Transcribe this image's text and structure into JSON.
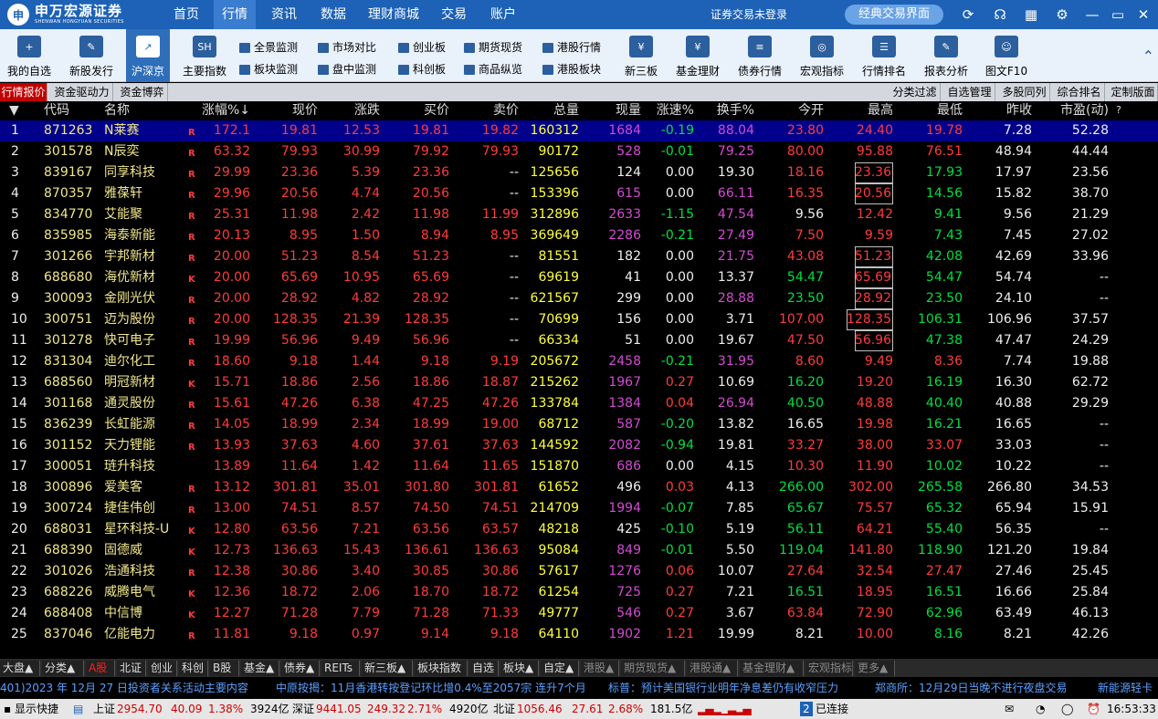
{
  "brand": {
    "cn": "申万宏源证券",
    "en": "SHENWAN HONGYUAN SECURITIES"
  },
  "top_menu": [
    "首页",
    "行情",
    "资讯",
    "数据",
    "理财商城",
    "交易",
    "账户"
  ],
  "top_menu_active": "行情",
  "trade_status": "证券交易未登录",
  "classic_button": "经典交易界面",
  "toolbar": {
    "big": [
      "我的自选",
      "新股发行",
      "沪深京",
      "主要指数",
      "新三板",
      "基金理财",
      "债券行情",
      "宏观指标",
      "行情排名",
      "报表分析",
      "图文F10"
    ],
    "active": "沪深京",
    "small_row1": [
      "全景监测",
      "市场对比",
      "创业板",
      "期货现货",
      "港股行情"
    ],
    "small_row2": [
      "板块监测",
      "盘中监测",
      "科创板",
      "商品纵览",
      "港股板块"
    ]
  },
  "subtabs_left": [
    "行情报价",
    "资金驱动力",
    "资金博弈"
  ],
  "subtabs_right": [
    "分类过滤",
    "自选管理",
    "多股同列",
    "综合排名",
    "定制版面"
  ],
  "columns": [
    "代码",
    "名称",
    "涨幅%↓",
    "现价",
    "涨跌",
    "买价",
    "卖价",
    "总量",
    "现量",
    "涨速%",
    "换手%",
    "今开",
    "最高",
    "最低",
    "昨收",
    "市盈(动)"
  ],
  "rows": [
    {
      "i": "1",
      "code": "871263",
      "name": "N莱赛",
      "flag": "R",
      "chg": "172.1",
      "price": "19.81",
      "diff": "12.53",
      "bid": "19.81",
      "ask": "19.82",
      "vol": "160312",
      "cur": "1684",
      "spd": "-0.19",
      "turn": "88.04",
      "open": "23.80",
      "high": "24.40",
      "low": "19.78",
      "prev": "7.28",
      "pe": "52.28"
    },
    {
      "i": "2",
      "code": "301578",
      "name": "N辰奕",
      "flag": "R",
      "chg": "63.32",
      "price": "79.93",
      "diff": "30.99",
      "bid": "79.92",
      "ask": "79.93",
      "vol": "90172",
      "cur": "528",
      "spd": "-0.01",
      "turn": "79.25",
      "open": "80.00",
      "high": "95.88",
      "low": "76.51",
      "prev": "48.94",
      "pe": "44.44"
    },
    {
      "i": "3",
      "code": "839167",
      "name": "同享科技",
      "flag": "R",
      "chg": "29.99",
      "price": "23.36",
      "diff": "5.39",
      "bid": "23.36",
      "ask": "--",
      "vol": "125656",
      "cur": "124",
      "spd": "0.00",
      "turn": "19.30",
      "open": "18.16",
      "high": "23.36",
      "low": "17.93",
      "prev": "17.97",
      "pe": "23.56"
    },
    {
      "i": "4",
      "code": "870357",
      "name": "雅葆轩",
      "flag": "R",
      "chg": "29.96",
      "price": "20.56",
      "diff": "4.74",
      "bid": "20.56",
      "ask": "--",
      "vol": "153396",
      "cur": "615",
      "spd": "0.00",
      "turn": "66.11",
      "open": "16.35",
      "high": "20.56",
      "low": "14.56",
      "prev": "15.82",
      "pe": "38.70"
    },
    {
      "i": "5",
      "code": "834770",
      "name": "艾能聚",
      "flag": "R",
      "chg": "25.31",
      "price": "11.98",
      "diff": "2.42",
      "bid": "11.98",
      "ask": "11.99",
      "vol": "312896",
      "cur": "2633",
      "spd": "-1.15",
      "turn": "47.54",
      "open": "9.56",
      "high": "12.42",
      "low": "9.41",
      "prev": "9.56",
      "pe": "21.29"
    },
    {
      "i": "6",
      "code": "835985",
      "name": "海泰新能",
      "flag": "R",
      "chg": "20.13",
      "price": "8.95",
      "diff": "1.50",
      "bid": "8.94",
      "ask": "8.95",
      "vol": "369649",
      "cur": "2286",
      "spd": "-0.21",
      "turn": "27.49",
      "open": "7.50",
      "high": "9.59",
      "low": "7.43",
      "prev": "7.45",
      "pe": "27.02"
    },
    {
      "i": "7",
      "code": "301266",
      "name": "宇邦新材",
      "flag": "R",
      "chg": "20.00",
      "price": "51.23",
      "diff": "8.54",
      "bid": "51.23",
      "ask": "--",
      "vol": "81551",
      "cur": "182",
      "spd": "0.00",
      "turn": "21.75",
      "open": "43.08",
      "high": "51.23",
      "low": "42.08",
      "prev": "42.69",
      "pe": "33.96"
    },
    {
      "i": "8",
      "code": "688680",
      "name": "海优新材",
      "flag": "K",
      "chg": "20.00",
      "price": "65.69",
      "diff": "10.95",
      "bid": "65.69",
      "ask": "--",
      "vol": "69619",
      "cur": "41",
      "spd": "0.00",
      "turn": "13.37",
      "open": "54.47",
      "high": "65.69",
      "low": "54.47",
      "prev": "54.74",
      "pe": "--"
    },
    {
      "i": "9",
      "code": "300093",
      "name": "金刚光伏",
      "flag": "R",
      "chg": "20.00",
      "price": "28.92",
      "diff": "4.82",
      "bid": "28.92",
      "ask": "--",
      "vol": "621567",
      "cur": "299",
      "spd": "0.00",
      "turn": "28.88",
      "open": "23.50",
      "high": "28.92",
      "low": "23.50",
      "prev": "24.10",
      "pe": "--"
    },
    {
      "i": "10",
      "code": "300751",
      "name": "迈为股份",
      "flag": "R",
      "chg": "20.00",
      "price": "128.35",
      "diff": "21.39",
      "bid": "128.35",
      "ask": "--",
      "vol": "70699",
      "cur": "156",
      "spd": "0.00",
      "turn": "3.71",
      "open": "107.00",
      "high": "128.35",
      "low": "106.31",
      "prev": "106.96",
      "pe": "37.57"
    },
    {
      "i": "11",
      "code": "301278",
      "name": "快可电子",
      "flag": "R",
      "chg": "19.99",
      "price": "56.96",
      "diff": "9.49",
      "bid": "56.96",
      "ask": "--",
      "vol": "66334",
      "cur": "51",
      "spd": "0.00",
      "turn": "19.67",
      "open": "47.50",
      "high": "56.96",
      "low": "47.38",
      "prev": "47.47",
      "pe": "24.29"
    },
    {
      "i": "12",
      "code": "831304",
      "name": "迪尔化工",
      "flag": "R",
      "chg": "18.60",
      "price": "9.18",
      "diff": "1.44",
      "bid": "9.18",
      "ask": "9.19",
      "vol": "205672",
      "cur": "2458",
      "spd": "-0.21",
      "turn": "31.95",
      "open": "8.60",
      "high": "9.49",
      "low": "8.36",
      "prev": "7.74",
      "pe": "19.88"
    },
    {
      "i": "13",
      "code": "688560",
      "name": "明冠新材",
      "flag": "K",
      "chg": "15.71",
      "price": "18.86",
      "diff": "2.56",
      "bid": "18.86",
      "ask": "18.87",
      "vol": "215262",
      "cur": "1967",
      "spd": "0.27",
      "turn": "10.69",
      "open": "16.20",
      "high": "19.20",
      "low": "16.19",
      "prev": "16.30",
      "pe": "62.72"
    },
    {
      "i": "14",
      "code": "301168",
      "name": "通灵股份",
      "flag": "R",
      "chg": "15.61",
      "price": "47.26",
      "diff": "6.38",
      "bid": "47.25",
      "ask": "47.26",
      "vol": "133784",
      "cur": "1384",
      "spd": "0.04",
      "turn": "26.94",
      "open": "40.50",
      "high": "48.88",
      "low": "40.40",
      "prev": "40.88",
      "pe": "29.29"
    },
    {
      "i": "15",
      "code": "836239",
      "name": "长虹能源",
      "flag": "R",
      "chg": "14.05",
      "price": "18.99",
      "diff": "2.34",
      "bid": "18.99",
      "ask": "19.00",
      "vol": "68712",
      "cur": "587",
      "spd": "-0.20",
      "turn": "13.82",
      "open": "16.65",
      "high": "19.98",
      "low": "16.21",
      "prev": "16.65",
      "pe": "--"
    },
    {
      "i": "16",
      "code": "301152",
      "name": "天力锂能",
      "flag": "R",
      "chg": "13.93",
      "price": "37.63",
      "diff": "4.60",
      "bid": "37.61",
      "ask": "37.63",
      "vol": "144592",
      "cur": "2082",
      "spd": "-0.94",
      "turn": "19.81",
      "open": "33.27",
      "high": "38.00",
      "low": "33.07",
      "prev": "33.03",
      "pe": "--"
    },
    {
      "i": "17",
      "code": "300051",
      "name": "琏升科技",
      "flag": "",
      "chg": "13.89",
      "price": "11.64",
      "diff": "1.42",
      "bid": "11.64",
      "ask": "11.65",
      "vol": "151870",
      "cur": "686",
      "spd": "0.00",
      "turn": "4.15",
      "open": "10.30",
      "high": "11.90",
      "low": "10.02",
      "prev": "10.22",
      "pe": "--"
    },
    {
      "i": "18",
      "code": "300896",
      "name": "爱美客",
      "flag": "R",
      "chg": "13.12",
      "price": "301.81",
      "diff": "35.01",
      "bid": "301.80",
      "ask": "301.81",
      "vol": "61652",
      "cur": "496",
      "spd": "0.03",
      "turn": "4.13",
      "open": "266.00",
      "high": "302.00",
      "low": "265.58",
      "prev": "266.80",
      "pe": "34.53"
    },
    {
      "i": "19",
      "code": "300724",
      "name": "捷佳伟创",
      "flag": "R",
      "chg": "13.00",
      "price": "74.51",
      "diff": "8.57",
      "bid": "74.50",
      "ask": "74.51",
      "vol": "214709",
      "cur": "1994",
      "spd": "-0.07",
      "turn": "7.85",
      "open": "65.67",
      "high": "75.57",
      "low": "65.32",
      "prev": "65.94",
      "pe": "15.91"
    },
    {
      "i": "20",
      "code": "688031",
      "name": "星环科技-U",
      "flag": "K",
      "chg": "12.80",
      "price": "63.56",
      "diff": "7.21",
      "bid": "63.56",
      "ask": "63.57",
      "vol": "48218",
      "cur": "425",
      "spd": "-0.10",
      "turn": "5.19",
      "open": "56.11",
      "high": "64.21",
      "low": "55.40",
      "prev": "56.35",
      "pe": "--"
    },
    {
      "i": "21",
      "code": "688390",
      "name": "固德威",
      "flag": "K",
      "chg": "12.73",
      "price": "136.63",
      "diff": "15.43",
      "bid": "136.61",
      "ask": "136.63",
      "vol": "95084",
      "cur": "849",
      "spd": "-0.01",
      "turn": "5.50",
      "open": "119.04",
      "high": "141.80",
      "low": "118.90",
      "prev": "121.20",
      "pe": "19.84"
    },
    {
      "i": "22",
      "code": "301026",
      "name": "浩通科技",
      "flag": "R",
      "chg": "12.38",
      "price": "30.86",
      "diff": "3.40",
      "bid": "30.85",
      "ask": "30.86",
      "vol": "57617",
      "cur": "1276",
      "spd": "0.06",
      "turn": "10.07",
      "open": "27.64",
      "high": "32.54",
      "low": "27.47",
      "prev": "27.46",
      "pe": "25.45"
    },
    {
      "i": "23",
      "code": "688226",
      "name": "威腾电气",
      "flag": "K",
      "chg": "12.36",
      "price": "18.72",
      "diff": "2.06",
      "bid": "18.70",
      "ask": "18.72",
      "vol": "61254",
      "cur": "725",
      "spd": "0.27",
      "turn": "7.21",
      "open": "16.51",
      "high": "18.95",
      "low": "16.51",
      "prev": "16.66",
      "pe": "25.84"
    },
    {
      "i": "24",
      "code": "688408",
      "name": "中信博",
      "flag": "K",
      "chg": "12.27",
      "price": "71.28",
      "diff": "7.79",
      "bid": "71.28",
      "ask": "71.33",
      "vol": "49777",
      "cur": "546",
      "spd": "0.27",
      "turn": "3.67",
      "open": "63.84",
      "high": "72.90",
      "low": "62.96",
      "prev": "63.49",
      "pe": "46.13"
    },
    {
      "i": "25",
      "code": "837046",
      "name": "亿能电力",
      "flag": "R",
      "chg": "11.81",
      "price": "9.18",
      "diff": "0.97",
      "bid": "9.14",
      "ask": "9.18",
      "vol": "64110",
      "cur": "1902",
      "spd": "1.21",
      "turn": "19.99",
      "open": "8.21",
      "high": "10.00",
      "low": "8.16",
      "prev": "8.21",
      "pe": "42.26"
    }
  ],
  "categories": [
    "大盘▲",
    "分类▲",
    "A股",
    "北证",
    "创业",
    "科创",
    "B股",
    "基金▲",
    "债券▲",
    "REITs",
    "新三板▲",
    "板块指数",
    "自选",
    "板块▲",
    "自定▲",
    "港股▲",
    "期货现货▲",
    "港股通▲",
    "基金理财▲",
    "宏观指标",
    "更多▲"
  ],
  "categories_active": "A股",
  "news": [
    "401)2023 年 12月 27 日投资者关系活动主要内容",
    "中原按揭：11月香港转按登记环比增0.4%至2057宗 连升7个月",
    "标普：预计美国银行业明年净息差仍有收窄压力",
    "郑商所：12月29日当晚不进行夜盘交易",
    "新能源轻卡"
  ],
  "status": {
    "quick": "显示快捷",
    "sh_label": "上证",
    "sh_value": "2954.70",
    "sh_change": "40.09",
    "sh_pct": "1.38%",
    "sh_amount": "3924亿",
    "sz_label": "深证",
    "sz_value": "9441.05",
    "sz_change": "249.32",
    "sz_pct": "2.71%",
    "sz_amount": "4920亿",
    "bz_label": "北证",
    "bz_value": "1056.46",
    "bz_change": "27.61",
    "bz_pct": "2.68%",
    "bz_amount": "181.5亿",
    "conn_count": "2",
    "conn_text": "已连接",
    "time": "16:53:33"
  },
  "colors": {
    "up": "#ff3b3b",
    "down": "#00e040",
    "select": "#00008a",
    "menu_bg": "#1d62b6"
  }
}
